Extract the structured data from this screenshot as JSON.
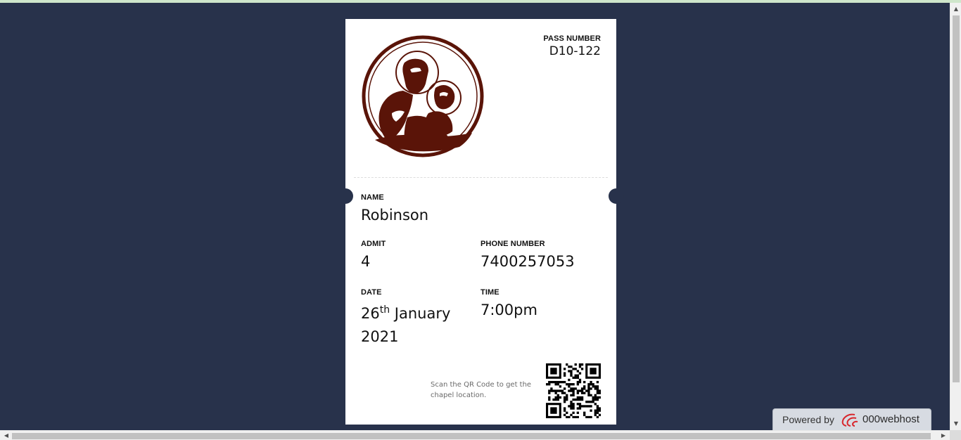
{
  "ticket": {
    "pass_number_label": "PASS NUMBER",
    "pass_number": "D10-122",
    "name_label": "NAME",
    "name": "Robinson",
    "admit_label": "ADMIT",
    "admit": "4",
    "phone_label": "PHONE NUMBER",
    "phone": "7400257053",
    "date_label": "DATE",
    "date_day": "26",
    "date_suffix": "th",
    "date_rest": " January 2021",
    "time_label": "TIME",
    "time": "7:00pm",
    "scan_text": "Scan the QR Code to get the chapel location.",
    "logo_icon": "saint-anthony-with-child-icon",
    "qr_icon": "qr-code-icon"
  },
  "badge": {
    "powered_label": "Powered by",
    "brand": "000webhost"
  },
  "colors": {
    "background": "#28324b",
    "ticket": "#ffffff",
    "logo": "#5a1408"
  }
}
